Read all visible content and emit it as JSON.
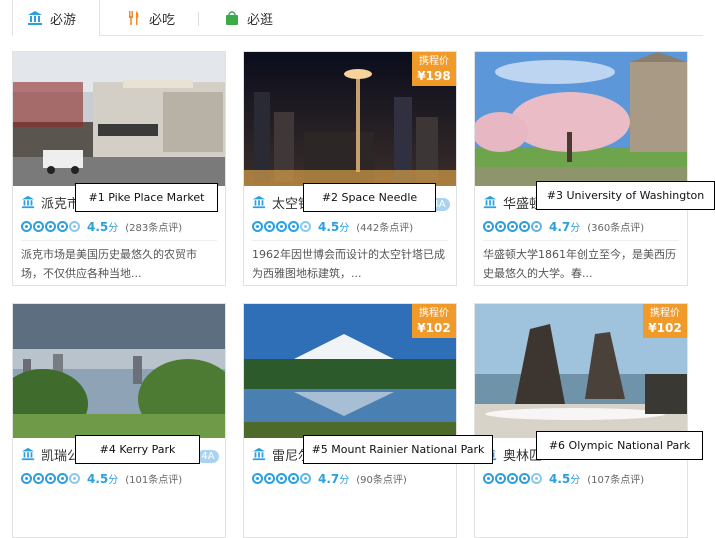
{
  "tabs": [
    {
      "label": "必游",
      "icon": "landmark-icon"
    },
    {
      "label": "必吃",
      "icon": "fork-knife-icon"
    },
    {
      "label": "必逛",
      "icon": "shopping-bag-icon"
    }
  ],
  "colors": {
    "accent": "#2aa0e0",
    "price_badge": "#f09a2a",
    "green_icon": "#3aab48",
    "orange_icon": "#f08a2a"
  },
  "price_label": "携程价",
  "cards": [
    {
      "title": "派克市",
      "label": "#1 Pike Place Market",
      "score": "4.5",
      "score_unit": "分",
      "reviews": "(283条点评)",
      "desc": "派克市场是美国历史最悠久的农贸市场，不仅供应各种当地...",
      "price": null,
      "badge": null
    },
    {
      "title": "太空针",
      "label": "#2 Space Needle",
      "score": "4.5",
      "score_unit": "分",
      "reviews": "(442条点评)",
      "desc": "1962年因世博会而设计的太空针塔已成为西雅图地标建筑，...",
      "price": "¥198",
      "badge": "4A"
    },
    {
      "title": "华盛顿",
      "label": "#3 University of Washington",
      "score": "4.7",
      "score_unit": "分",
      "reviews": "(360条点评)",
      "desc": "华盛顿大学1861年创立至今，是美西历史最悠久的大学。春...",
      "price": null,
      "badge": null
    },
    {
      "title": "凯瑞公",
      "label": "#4 Kerry Park",
      "score": "4.5",
      "score_unit": "分",
      "reviews": "(101条点评)",
      "desc": "",
      "price": null,
      "badge": "4A"
    },
    {
      "title": "雷尼尔",
      "label": "#5 Mount Rainier National Park",
      "score": "4.7",
      "score_unit": "分",
      "reviews": "(90条点评)",
      "desc": "",
      "price": "¥102",
      "badge": null
    },
    {
      "title": "奥林匹",
      "label": "#6 Olympic National Park",
      "score": "4.5",
      "score_unit": "分",
      "reviews": "(107条点评)",
      "desc": "",
      "price": "¥102",
      "badge": null
    }
  ]
}
